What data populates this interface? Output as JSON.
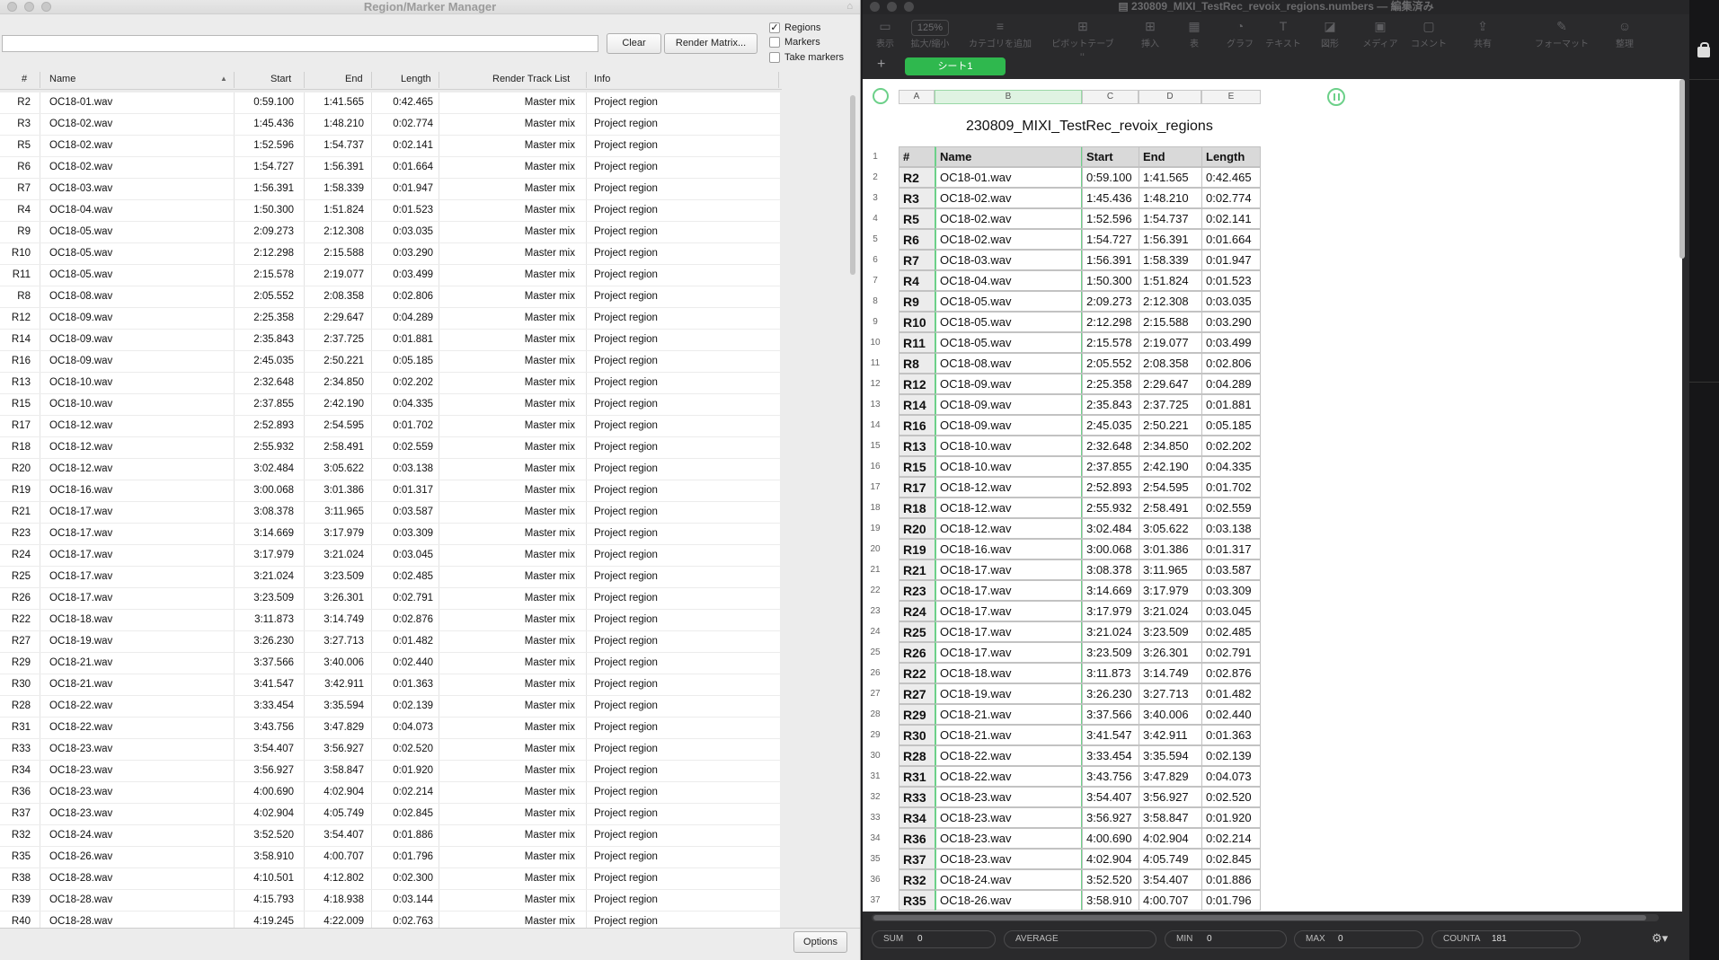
{
  "left_window": {
    "title": "Region/Marker Manager",
    "search_value": "",
    "clear_label": "Clear",
    "render_matrix_label": "Render Matrix...",
    "checkboxes": [
      {
        "label": "Regions",
        "checked": true
      },
      {
        "label": "Markers",
        "checked": false
      },
      {
        "label": "Take markers",
        "checked": false
      }
    ],
    "columns": [
      "#",
      "Name",
      "Start",
      "End",
      "Length",
      "Render Track List",
      "Info"
    ],
    "rows": [
      [
        "R2",
        "OC18-01.wav",
        "0:59.100",
        "1:41.565",
        "0:42.465",
        "Master mix",
        "Project region"
      ],
      [
        "R3",
        "OC18-02.wav",
        "1:45.436",
        "1:48.210",
        "0:02.774",
        "Master mix",
        "Project region"
      ],
      [
        "R5",
        "OC18-02.wav",
        "1:52.596",
        "1:54.737",
        "0:02.141",
        "Master mix",
        "Project region"
      ],
      [
        "R6",
        "OC18-02.wav",
        "1:54.727",
        "1:56.391",
        "0:01.664",
        "Master mix",
        "Project region"
      ],
      [
        "R7",
        "OC18-03.wav",
        "1:56.391",
        "1:58.339",
        "0:01.947",
        "Master mix",
        "Project region"
      ],
      [
        "R4",
        "OC18-04.wav",
        "1:50.300",
        "1:51.824",
        "0:01.523",
        "Master mix",
        "Project region"
      ],
      [
        "R9",
        "OC18-05.wav",
        "2:09.273",
        "2:12.308",
        "0:03.035",
        "Master mix",
        "Project region"
      ],
      [
        "R10",
        "OC18-05.wav",
        "2:12.298",
        "2:15.588",
        "0:03.290",
        "Master mix",
        "Project region"
      ],
      [
        "R11",
        "OC18-05.wav",
        "2:15.578",
        "2:19.077",
        "0:03.499",
        "Master mix",
        "Project region"
      ],
      [
        "R8",
        "OC18-08.wav",
        "2:05.552",
        "2:08.358",
        "0:02.806",
        "Master mix",
        "Project region"
      ],
      [
        "R12",
        "OC18-09.wav",
        "2:25.358",
        "2:29.647",
        "0:04.289",
        "Master mix",
        "Project region"
      ],
      [
        "R14",
        "OC18-09.wav",
        "2:35.843",
        "2:37.725",
        "0:01.881",
        "Master mix",
        "Project region"
      ],
      [
        "R16",
        "OC18-09.wav",
        "2:45.035",
        "2:50.221",
        "0:05.185",
        "Master mix",
        "Project region"
      ],
      [
        "R13",
        "OC18-10.wav",
        "2:32.648",
        "2:34.850",
        "0:02.202",
        "Master mix",
        "Project region"
      ],
      [
        "R15",
        "OC18-10.wav",
        "2:37.855",
        "2:42.190",
        "0:04.335",
        "Master mix",
        "Project region"
      ],
      [
        "R17",
        "OC18-12.wav",
        "2:52.893",
        "2:54.595",
        "0:01.702",
        "Master mix",
        "Project region"
      ],
      [
        "R18",
        "OC18-12.wav",
        "2:55.932",
        "2:58.491",
        "0:02.559",
        "Master mix",
        "Project region"
      ],
      [
        "R20",
        "OC18-12.wav",
        "3:02.484",
        "3:05.622",
        "0:03.138",
        "Master mix",
        "Project region"
      ],
      [
        "R19",
        "OC18-16.wav",
        "3:00.068",
        "3:01.386",
        "0:01.317",
        "Master mix",
        "Project region"
      ],
      [
        "R21",
        "OC18-17.wav",
        "3:08.378",
        "3:11.965",
        "0:03.587",
        "Master mix",
        "Project region"
      ],
      [
        "R23",
        "OC18-17.wav",
        "3:14.669",
        "3:17.979",
        "0:03.309",
        "Master mix",
        "Project region"
      ],
      [
        "R24",
        "OC18-17.wav",
        "3:17.979",
        "3:21.024",
        "0:03.045",
        "Master mix",
        "Project region"
      ],
      [
        "R25",
        "OC18-17.wav",
        "3:21.024",
        "3:23.509",
        "0:02.485",
        "Master mix",
        "Project region"
      ],
      [
        "R26",
        "OC18-17.wav",
        "3:23.509",
        "3:26.301",
        "0:02.791",
        "Master mix",
        "Project region"
      ],
      [
        "R22",
        "OC18-18.wav",
        "3:11.873",
        "3:14.749",
        "0:02.876",
        "Master mix",
        "Project region"
      ],
      [
        "R27",
        "OC18-19.wav",
        "3:26.230",
        "3:27.713",
        "0:01.482",
        "Master mix",
        "Project region"
      ],
      [
        "R29",
        "OC18-21.wav",
        "3:37.566",
        "3:40.006",
        "0:02.440",
        "Master mix",
        "Project region"
      ],
      [
        "R30",
        "OC18-21.wav",
        "3:41.547",
        "3:42.911",
        "0:01.363",
        "Master mix",
        "Project region"
      ],
      [
        "R28",
        "OC18-22.wav",
        "3:33.454",
        "3:35.594",
        "0:02.139",
        "Master mix",
        "Project region"
      ],
      [
        "R31",
        "OC18-22.wav",
        "3:43.756",
        "3:47.829",
        "0:04.073",
        "Master mix",
        "Project region"
      ],
      [
        "R33",
        "OC18-23.wav",
        "3:54.407",
        "3:56.927",
        "0:02.520",
        "Master mix",
        "Project region"
      ],
      [
        "R34",
        "OC18-23.wav",
        "3:56.927",
        "3:58.847",
        "0:01.920",
        "Master mix",
        "Project region"
      ],
      [
        "R36",
        "OC18-23.wav",
        "4:00.690",
        "4:02.904",
        "0:02.214",
        "Master mix",
        "Project region"
      ],
      [
        "R37",
        "OC18-23.wav",
        "4:02.904",
        "4:05.749",
        "0:02.845",
        "Master mix",
        "Project region"
      ],
      [
        "R32",
        "OC18-24.wav",
        "3:52.520",
        "3:54.407",
        "0:01.886",
        "Master mix",
        "Project region"
      ],
      [
        "R35",
        "OC18-26.wav",
        "3:58.910",
        "4:00.707",
        "0:01.796",
        "Master mix",
        "Project region"
      ],
      [
        "R38",
        "OC18-28.wav",
        "4:10.501",
        "4:12.802",
        "0:02.300",
        "Master mix",
        "Project region"
      ],
      [
        "R39",
        "OC18-28.wav",
        "4:15.793",
        "4:18.938",
        "0:03.144",
        "Master mix",
        "Project region"
      ],
      [
        "R40",
        "OC18-28.wav",
        "4:19.245",
        "4:22.009",
        "0:02.763",
        "Master mix",
        "Project region"
      ]
    ],
    "options_label": "Options"
  },
  "right_window": {
    "title": "230809_MIXI_TestRec_revoix_regions.numbers",
    "title_suffix": "— 編集済み",
    "toolbar": [
      {
        "label": "表示",
        "icon": "sidebar-icon"
      },
      {
        "label": "拡大/縮小",
        "icon": "zoom-icon",
        "value": "125%"
      },
      {
        "label": "カテゴリを追加",
        "icon": "list-icon"
      },
      {
        "label": "ピボットテーブル",
        "icon": "pivot-icon"
      },
      {
        "label": "挿入",
        "icon": "insert-icon"
      },
      {
        "label": "表",
        "icon": "table-icon"
      },
      {
        "label": "グラフ",
        "icon": "chart-icon"
      },
      {
        "label": "テキスト",
        "icon": "text-icon"
      },
      {
        "label": "図形",
        "icon": "shape-icon"
      },
      {
        "label": "メディア",
        "icon": "media-icon"
      },
      {
        "label": "コメント",
        "icon": "comment-icon"
      },
      {
        "label": "共有",
        "icon": "share-icon"
      },
      {
        "label": "フォーマット",
        "icon": "format-icon"
      },
      {
        "label": "整理",
        "icon": "organize-icon"
      }
    ],
    "add_sheet_label": "+",
    "sheet_tab": "シート1",
    "column_letters": [
      "A",
      "B",
      "C",
      "D",
      "E"
    ],
    "table_title": "230809_MIXI_TestRec_revoix_regions",
    "header_row": [
      "#",
      "Name",
      "Start",
      "End",
      "Length"
    ],
    "rows": [
      [
        "R2",
        "OC18-01.wav",
        "0:59.100",
        "1:41.565",
        "0:42.465"
      ],
      [
        "R3",
        "OC18-02.wav",
        "1:45.436",
        "1:48.210",
        "0:02.774"
      ],
      [
        "R5",
        "OC18-02.wav",
        "1:52.596",
        "1:54.737",
        "0:02.141"
      ],
      [
        "R6",
        "OC18-02.wav",
        "1:54.727",
        "1:56.391",
        "0:01.664"
      ],
      [
        "R7",
        "OC18-03.wav",
        "1:56.391",
        "1:58.339",
        "0:01.947"
      ],
      [
        "R4",
        "OC18-04.wav",
        "1:50.300",
        "1:51.824",
        "0:01.523"
      ],
      [
        "R9",
        "OC18-05.wav",
        "2:09.273",
        "2:12.308",
        "0:03.035"
      ],
      [
        "R10",
        "OC18-05.wav",
        "2:12.298",
        "2:15.588",
        "0:03.290"
      ],
      [
        "R11",
        "OC18-05.wav",
        "2:15.578",
        "2:19.077",
        "0:03.499"
      ],
      [
        "R8",
        "OC18-08.wav",
        "2:05.552",
        "2:08.358",
        "0:02.806"
      ],
      [
        "R12",
        "OC18-09.wav",
        "2:25.358",
        "2:29.647",
        "0:04.289"
      ],
      [
        "R14",
        "OC18-09.wav",
        "2:35.843",
        "2:37.725",
        "0:01.881"
      ],
      [
        "R16",
        "OC18-09.wav",
        "2:45.035",
        "2:50.221",
        "0:05.185"
      ],
      [
        "R13",
        "OC18-10.wav",
        "2:32.648",
        "2:34.850",
        "0:02.202"
      ],
      [
        "R15",
        "OC18-10.wav",
        "2:37.855",
        "2:42.190",
        "0:04.335"
      ],
      [
        "R17",
        "OC18-12.wav",
        "2:52.893",
        "2:54.595",
        "0:01.702"
      ],
      [
        "R18",
        "OC18-12.wav",
        "2:55.932",
        "2:58.491",
        "0:02.559"
      ],
      [
        "R20",
        "OC18-12.wav",
        "3:02.484",
        "3:05.622",
        "0:03.138"
      ],
      [
        "R19",
        "OC18-16.wav",
        "3:00.068",
        "3:01.386",
        "0:01.317"
      ],
      [
        "R21",
        "OC18-17.wav",
        "3:08.378",
        "3:11.965",
        "0:03.587"
      ],
      [
        "R23",
        "OC18-17.wav",
        "3:14.669",
        "3:17.979",
        "0:03.309"
      ],
      [
        "R24",
        "OC18-17.wav",
        "3:17.979",
        "3:21.024",
        "0:03.045"
      ],
      [
        "R25",
        "OC18-17.wav",
        "3:21.024",
        "3:23.509",
        "0:02.485"
      ],
      [
        "R26",
        "OC18-17.wav",
        "3:23.509",
        "3:26.301",
        "0:02.791"
      ],
      [
        "R22",
        "OC18-18.wav",
        "3:11.873",
        "3:14.749",
        "0:02.876"
      ],
      [
        "R27",
        "OC18-19.wav",
        "3:26.230",
        "3:27.713",
        "0:01.482"
      ],
      [
        "R29",
        "OC18-21.wav",
        "3:37.566",
        "3:40.006",
        "0:02.440"
      ],
      [
        "R30",
        "OC18-21.wav",
        "3:41.547",
        "3:42.911",
        "0:01.363"
      ],
      [
        "R28",
        "OC18-22.wav",
        "3:33.454",
        "3:35.594",
        "0:02.139"
      ],
      [
        "R31",
        "OC18-22.wav",
        "3:43.756",
        "3:47.829",
        "0:04.073"
      ],
      [
        "R33",
        "OC18-23.wav",
        "3:54.407",
        "3:56.927",
        "0:02.520"
      ],
      [
        "R34",
        "OC18-23.wav",
        "3:56.927",
        "3:58.847",
        "0:01.920"
      ],
      [
        "R36",
        "OC18-23.wav",
        "4:00.690",
        "4:02.904",
        "0:02.214"
      ],
      [
        "R37",
        "OC18-23.wav",
        "4:02.904",
        "4:05.749",
        "0:02.845"
      ],
      [
        "R32",
        "OC18-24.wav",
        "3:52.520",
        "3:54.407",
        "0:01.886"
      ],
      [
        "R35",
        "OC18-26.wav",
        "3:58.910",
        "4:00.707",
        "0:01.796"
      ]
    ],
    "status": [
      {
        "label": "SUM",
        "value": "0"
      },
      {
        "label": "AVERAGE",
        "value": ""
      },
      {
        "label": "MIN",
        "value": "0"
      },
      {
        "label": "MAX",
        "value": "0"
      },
      {
        "label": "COUNTA",
        "value": "181"
      }
    ],
    "status_gear_icon": "gear-icon",
    "colors": {
      "accent_green": "#2fb84e",
      "selection_green": "#6cd089"
    }
  }
}
